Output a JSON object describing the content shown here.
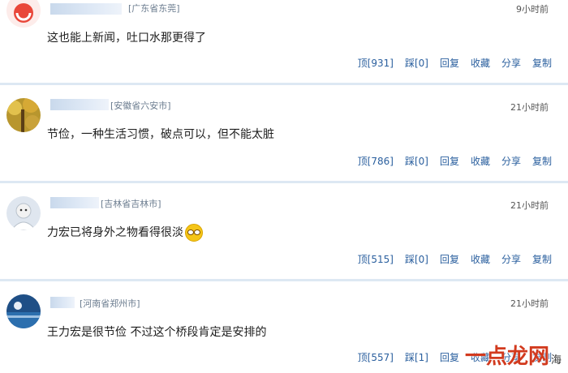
{
  "comments": [
    {
      "location": "[广东省东莞]",
      "time": "9小时前",
      "text": "这也能上新闻，吐口水那更得了",
      "up": "顶[931]",
      "down": "踩[0]",
      "reply": "回复",
      "fav": "收藏",
      "share": "分享",
      "copy": "复制"
    },
    {
      "location": "[安徽省六安市]",
      "time": "21小时前",
      "text": "节俭，一种生活习惯，破点可以，但不能太脏",
      "up": "顶[786]",
      "down": "踩[0]",
      "reply": "回复",
      "fav": "收藏",
      "share": "分享",
      "copy": "复制"
    },
    {
      "location": "[吉林省吉林市]",
      "time": "21小时前",
      "text": "力宏已将身外之物看得很淡",
      "up": "顶[515]",
      "down": "踩[0]",
      "reply": "回复",
      "fav": "收藏",
      "share": "分享",
      "copy": "复制"
    },
    {
      "location": "[河南省郑州市]",
      "time": "21小时前",
      "text": "王力宏是很节俭  不过这个桥段肯定是安排的",
      "up": "顶[557]",
      "down": "踩[1]",
      "reply": "回复",
      "fav": "收藏",
      "share": "分享",
      "copy": "复制"
    }
  ],
  "watermark": {
    "main": "一点龙网",
    "sub": "海"
  }
}
